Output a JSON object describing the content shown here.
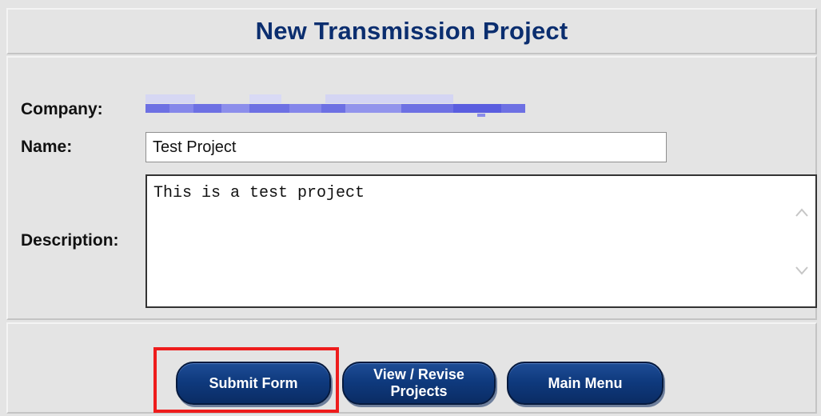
{
  "form": {
    "title": "New Transmission Project",
    "company_label": "Company:",
    "name_label": "Name:",
    "name_value": "Test Project",
    "description_label": "Description:",
    "description_value": "This is a test project"
  },
  "buttons": {
    "submit": "Submit Form",
    "view_revise_line1": "View / Revise",
    "view_revise_line2": "Projects",
    "main_menu": "Main Menu"
  },
  "colors": {
    "title": "#0b2e6f",
    "button": "#0f3a7e",
    "highlight": "#ee1c1c",
    "company_redacted": "#6f73e6"
  },
  "icons": {
    "scroll_up": "chevron-up-icon",
    "scroll_down": "chevron-down-icon"
  }
}
